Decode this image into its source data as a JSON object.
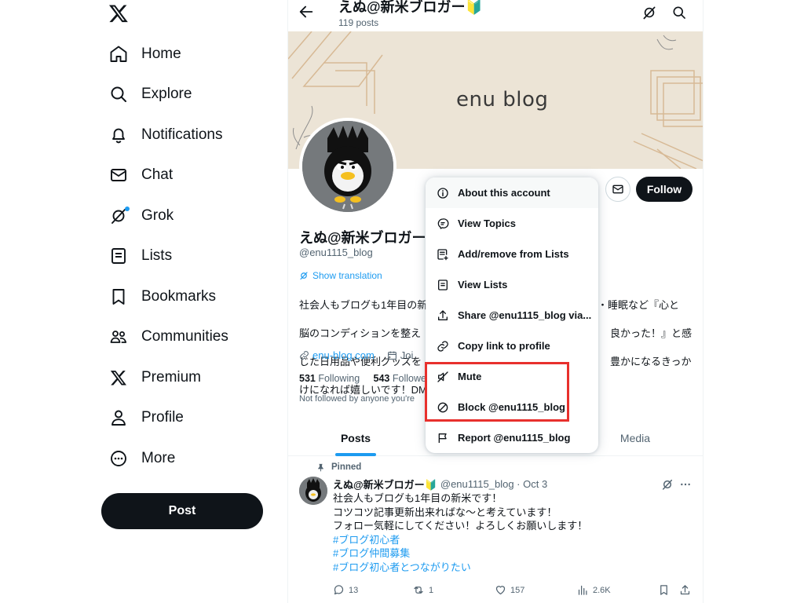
{
  "sidebar": {
    "logo": "x-logo",
    "items": [
      {
        "label": "Home",
        "icon": "home-icon"
      },
      {
        "label": "Explore",
        "icon": "search-icon"
      },
      {
        "label": "Notifications",
        "icon": "bell-icon"
      },
      {
        "label": "Chat",
        "icon": "mail-icon"
      },
      {
        "label": "Grok",
        "icon": "grok-icon"
      },
      {
        "label": "Lists",
        "icon": "lists-icon"
      },
      {
        "label": "Bookmarks",
        "icon": "bookmark-icon"
      },
      {
        "label": "Communities",
        "icon": "communities-icon"
      },
      {
        "label": "Premium",
        "icon": "x-premium-icon"
      },
      {
        "label": "Profile",
        "icon": "profile-icon"
      },
      {
        "label": "More",
        "icon": "more-circle-icon"
      }
    ],
    "post_label": "Post"
  },
  "header": {
    "name": "えぬ@新米ブロガー🔰",
    "post_count": "119 posts"
  },
  "banner": {
    "text": "enu blog",
    "color": "#ece4d6"
  },
  "profile": {
    "name": "えぬ@新米ブロガー",
    "handle": "@enu1115_blog",
    "show_translation": "Show translation",
    "bio_line1": "社会人もブログも1年目の新",
    "bio_line1_end": "・睡眠など『心と",
    "bio_line2": "脳のコンディションを整え",
    "bio_line2_end": "良かった！』と感",
    "bio_line3": "じた日用品や便利グッズを",
    "bio_line3_end": "豊かになるきっか",
    "bio_line4": "けになれば嬉しいです！DM",
    "website": "enu-blog.com",
    "joined_partial": "Joi",
    "following_count": "531",
    "following_label": "Following",
    "followers_count": "543",
    "followers_label": "Followe",
    "not_followed": "Not followed by anyone you're",
    "follow_label": "Follow"
  },
  "tabs": [
    {
      "label": "Posts",
      "active": true
    },
    {
      "label": "Media",
      "active": false
    }
  ],
  "pinned_tweet": {
    "pinned_label": "Pinned",
    "name": "えぬ@新米ブロガー🔰",
    "handle_time": "@enu1115_blog · Oct 3",
    "lines": [
      "社会人もブログも1年目の新米です！",
      "コツコツ記事更新出来ればな〜と考えています！",
      "フォロー気軽にしてください！よろしくお願いします！"
    ],
    "hashtags": [
      "#ブログ初心者",
      "#ブログ仲間募集",
      "#ブログ初心者とつながりたい"
    ],
    "replies": "13",
    "reposts": "1",
    "likes": "157",
    "views": "2.6K"
  },
  "menu": {
    "items": [
      {
        "label": "About this account",
        "icon": "info-icon"
      },
      {
        "label": "View Topics",
        "icon": "topics-icon"
      },
      {
        "label": "Add/remove from Lists",
        "icon": "list-add-icon"
      },
      {
        "label": "View Lists",
        "icon": "lists-icon"
      },
      {
        "label": "Share @enu1115_blog via...",
        "icon": "share-icon"
      },
      {
        "label": "Copy link to profile",
        "icon": "link-icon"
      },
      {
        "label": "Mute",
        "icon": "mute-icon"
      },
      {
        "label": "Block @enu1115_blog",
        "icon": "block-icon"
      },
      {
        "label": "Report @enu1115_blog",
        "icon": "flag-icon"
      }
    ],
    "highlight_color": "#e8302d"
  },
  "colors": {
    "accent": "#1d9bf0",
    "text": "#0f1419",
    "muted": "#536471"
  }
}
